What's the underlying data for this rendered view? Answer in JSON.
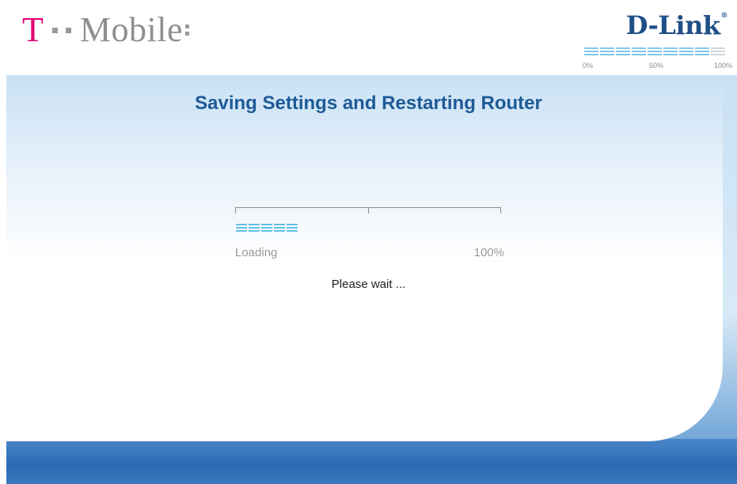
{
  "header": {
    "brand_left": {
      "letter": "T",
      "word": "Mobile"
    },
    "brand_right": {
      "name": "D-Link",
      "reg_mark": "®"
    },
    "mini_progress": {
      "labels": [
        "0%",
        "50%",
        "100%"
      ],
      "filled_fraction": 0.9
    }
  },
  "main": {
    "title": "Saving Settings and Restarting Router",
    "progress": {
      "label": "Loading",
      "percent_text": "100%",
      "fill_fraction": 0.28
    },
    "status": "Please wait ..."
  },
  "colors": {
    "tmobile_magenta": "#e20074",
    "dlink_blue": "#1f4f86",
    "title_blue": "#1d5a96",
    "progress_cyan": "#5fbfe6"
  }
}
